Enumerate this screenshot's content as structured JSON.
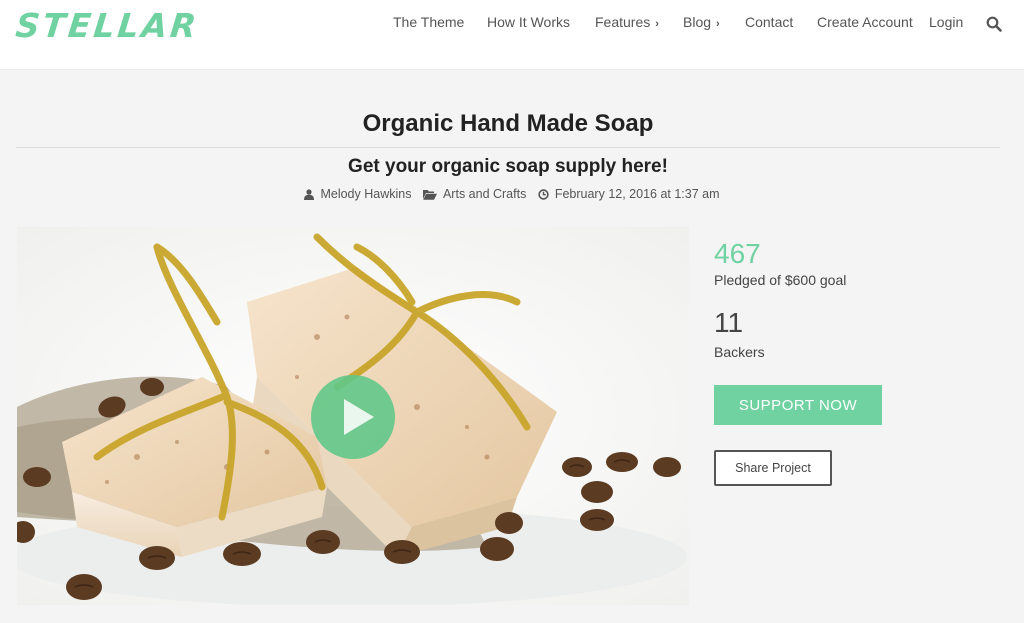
{
  "brand": {
    "logo_text": "STELLAR",
    "accent": "#6fd2a0"
  },
  "nav": {
    "items": [
      {
        "label": "The Theme",
        "has_chevron": false
      },
      {
        "label": "How It Works",
        "has_chevron": false
      },
      {
        "label": "Features",
        "has_chevron": true
      },
      {
        "label": "Blog",
        "has_chevron": true
      },
      {
        "label": "Contact",
        "has_chevron": false
      },
      {
        "label": "Create Account",
        "has_chevron": false
      },
      {
        "label": "Login",
        "has_chevron": false
      }
    ],
    "chevron": "›",
    "search_icon": "search-icon"
  },
  "project": {
    "title": "Organic Hand Made Soap",
    "subtitle": "Get your organic soap supply here!",
    "author": "Melody Hawkins",
    "category": "Arts and Crafts",
    "date": "February 12, 2016 at 1:37 am"
  },
  "stats": {
    "pledged": "467",
    "pledged_label": "Pledged of $600 goal",
    "backers": "11",
    "backers_label": "Backers"
  },
  "actions": {
    "support_label": "SUPPORT NOW",
    "share_label": "Share Project"
  }
}
